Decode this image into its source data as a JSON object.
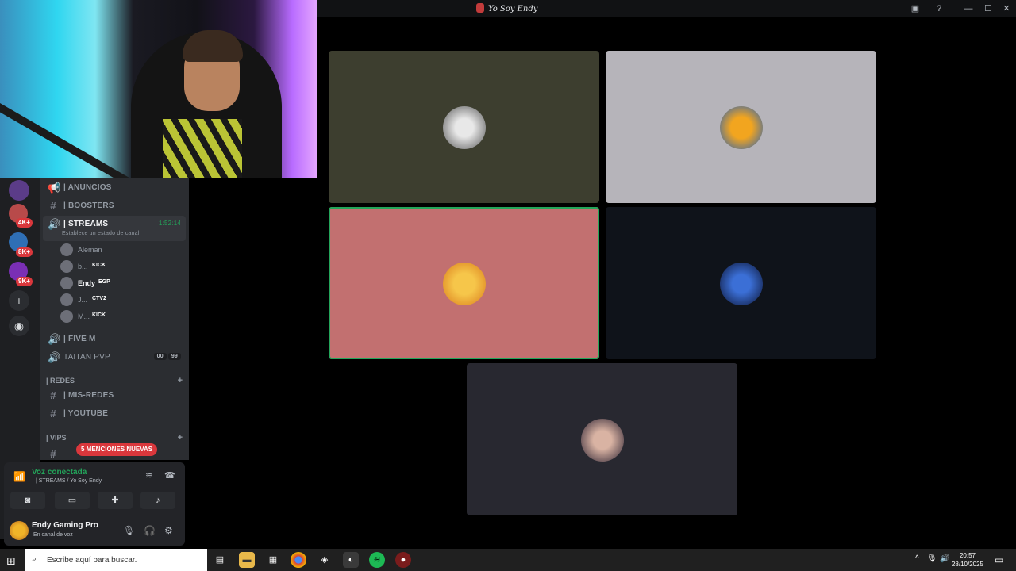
{
  "window": {
    "title": "Yo Soy Endy",
    "controls": {
      "minimize": "—",
      "maximize": "☐",
      "close": "✕"
    }
  },
  "rail": {
    "badges": [
      "4K+",
      "8K+",
      "9K+"
    ]
  },
  "channels": {
    "anuncios": "| ANUNCIOS",
    "boosters": "| BOOSTERS",
    "streams": {
      "label": "| STREAMS",
      "time": "1:52:14",
      "status": "Establece un estado de canal"
    },
    "users": [
      {
        "name": "Aleman",
        "tag": ""
      },
      {
        "name": "b...",
        "tag": "KICK"
      },
      {
        "name": "Endy",
        "tag": "EGP"
      },
      {
        "name": "J...",
        "tag": "CTV2"
      },
      {
        "name": "M...",
        "tag": "KICK"
      }
    ],
    "fivem": "| FIVE M",
    "taitan": {
      "label": "TAITAN PVP",
      "count_a": "00",
      "count_b": "99"
    },
    "cat_redes": "| REDES",
    "misredes": "| MIS-REDES",
    "youtube": "| YOUTUBE",
    "cat_vips": "| VIPS",
    "mentions": "5 MENCIONES NUEVAS"
  },
  "voice": {
    "title": "Voz conectada",
    "subtitle": "| STREAMS / Yo Soy Endy"
  },
  "user": {
    "name": "Endy Gaming Pro",
    "status": "En canal de voz"
  },
  "taskbar": {
    "search_placeholder": "Escribe aquí para buscar.",
    "time": "20:57",
    "date": "28/10/2025"
  },
  "colors": {
    "tile1": "#3d3e2f",
    "tile2": "#b6b4ba",
    "tile3": "#c27070",
    "tile4": "#0f131a",
    "tile5": "#282830",
    "speaking": "#23a55a",
    "alert": "#da373c"
  }
}
